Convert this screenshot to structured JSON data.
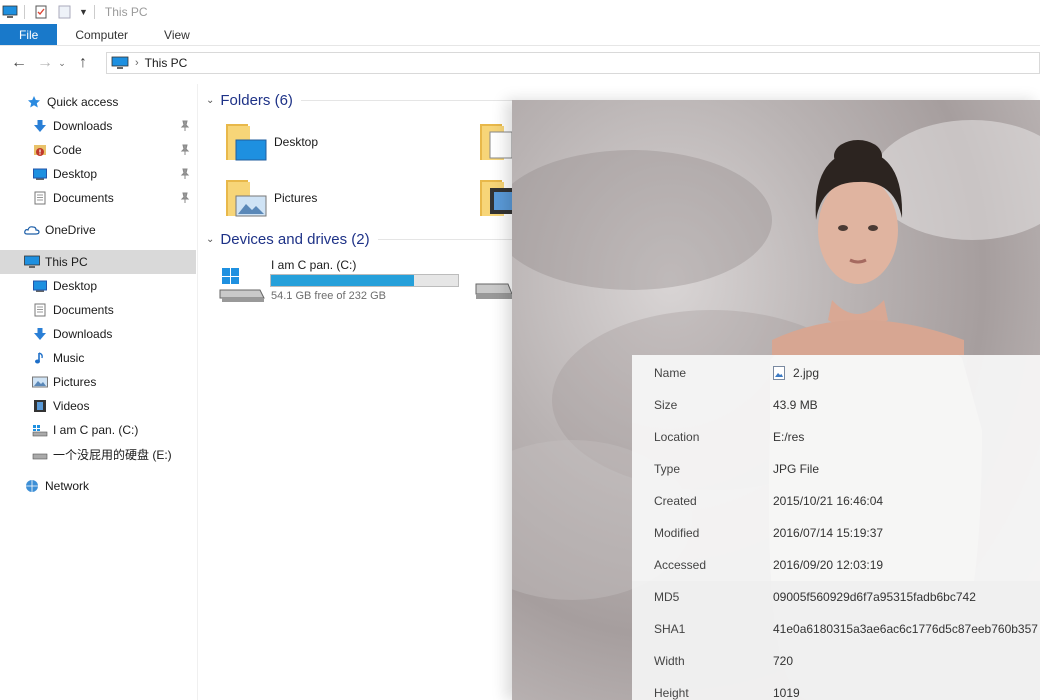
{
  "window": {
    "title": "This PC"
  },
  "ribbon": {
    "tabs": [
      "File",
      "Computer",
      "View"
    ]
  },
  "address": {
    "path": "This PC"
  },
  "sidebar": {
    "quick_access": "Quick access",
    "quick_items": [
      "Downloads",
      "Code",
      "Desktop",
      "Documents"
    ],
    "onedrive": "OneDrive",
    "this_pc": "This PC",
    "pc_items": [
      "Desktop",
      "Documents",
      "Downloads",
      "Music",
      "Pictures",
      "Videos",
      "I am C pan. (C:)",
      "一个没屁用的硬盘 (E:)"
    ],
    "network": "Network"
  },
  "content": {
    "folders_header": "Folders (6)",
    "folders": [
      "Desktop",
      "Pictures"
    ],
    "drives_header": "Devices and drives (2)",
    "drive_c": {
      "name": "I am C pan. (C:)",
      "free_text": "54.1 GB free of 232 GB",
      "used_fraction": 0.767
    }
  },
  "file_info": {
    "rows": [
      {
        "label": "Name",
        "value": "2.jpg"
      },
      {
        "label": "Size",
        "value": "43.9 MB"
      },
      {
        "label": "Location",
        "value": "E:/res"
      },
      {
        "label": "Type",
        "value": "JPG File"
      },
      {
        "label": "Created",
        "value": "2015/10/21 16:46:04"
      },
      {
        "label": "Modified",
        "value": "2016/07/14 15:19:37"
      },
      {
        "label": "Accessed",
        "value": "2016/09/20 12:03:19"
      },
      {
        "label": "MD5",
        "value": "09005f560929d6f7a95315fadb6bc742"
      },
      {
        "label": "SHA1",
        "value": "41e0a6180315a3ae6ac6c1776d5c87eeb760b357"
      },
      {
        "label": "Width",
        "value": "720"
      },
      {
        "label": "Height",
        "value": "1019"
      }
    ]
  },
  "colors": {
    "accent": "#1979ca",
    "selected": "#d9d9d9",
    "drive_fill": "#26a0da",
    "group_head": "#1e3287"
  }
}
